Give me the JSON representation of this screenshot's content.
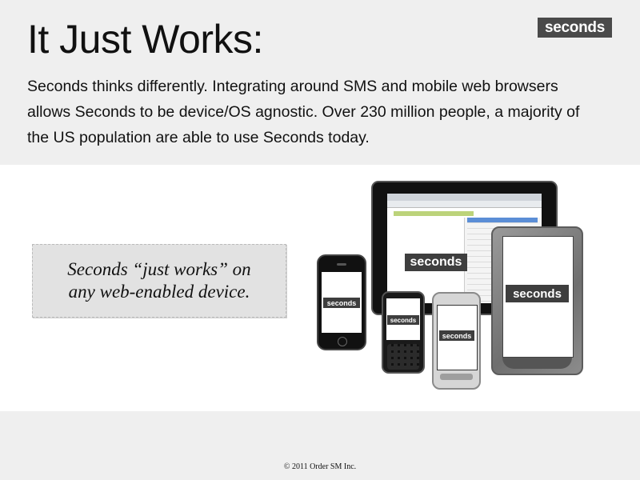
{
  "slide": {
    "title": "It Just Works:",
    "brand": "seconds",
    "body": "Seconds thinks differently. Integrating around SMS and mobile web browsers allows Seconds to be device/OS agnostic.  Over 230 million people, a majority of the US population are able to use Seconds today.",
    "quote_line1": "Seconds “just works” on",
    "quote_line2": "any web-enabled device."
  },
  "devices": {
    "tablet_logo": "seconds",
    "reader_logo": "seconds",
    "iphone_logo": "seconds",
    "palm_logo": "seconds",
    "android_logo": "seconds"
  },
  "footer": "© 2011 Order SM Inc.",
  "colors": {
    "top_band": "#efefef",
    "mid_band": "#ffffff",
    "badge_bg": "#4a4a4a",
    "quote_bg": "#e2e2e2"
  }
}
